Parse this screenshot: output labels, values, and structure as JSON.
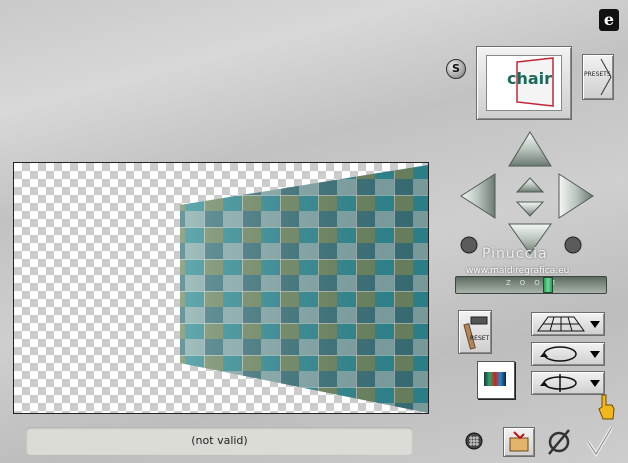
{
  "top": {
    "logo_letter": "e",
    "s_button_label": "S"
  },
  "thumbnail": {
    "text": "chair"
  },
  "presets": {
    "label": "PRESETS"
  },
  "watermark": {
    "name": "Pinuccia",
    "url": "www.maidiregrafica.eu"
  },
  "zoom": {
    "label": "ZOOM",
    "level": 0.62
  },
  "reset": {
    "label": "RESET"
  },
  "status": {
    "text": "(not valid)"
  },
  "icons": {
    "nav_up": "arrow-up-icon",
    "nav_down": "arrow-down-icon",
    "nav_left": "arrow-left-icon",
    "nav_right": "arrow-right-icon",
    "grid_plane": "grid-plane-icon",
    "rotate": "rotate-icon",
    "rotate_axis": "rotate-axis-icon",
    "grid": "grid-icon",
    "open": "folder-open-icon",
    "cancel": "cancel-icon",
    "ok": "checkmark-icon",
    "help": "hand-pointer-icon"
  },
  "colors": {
    "tile_teal": "#2f8c96",
    "tile_olive": "#7f8a58",
    "checker": "#cccccc"
  }
}
